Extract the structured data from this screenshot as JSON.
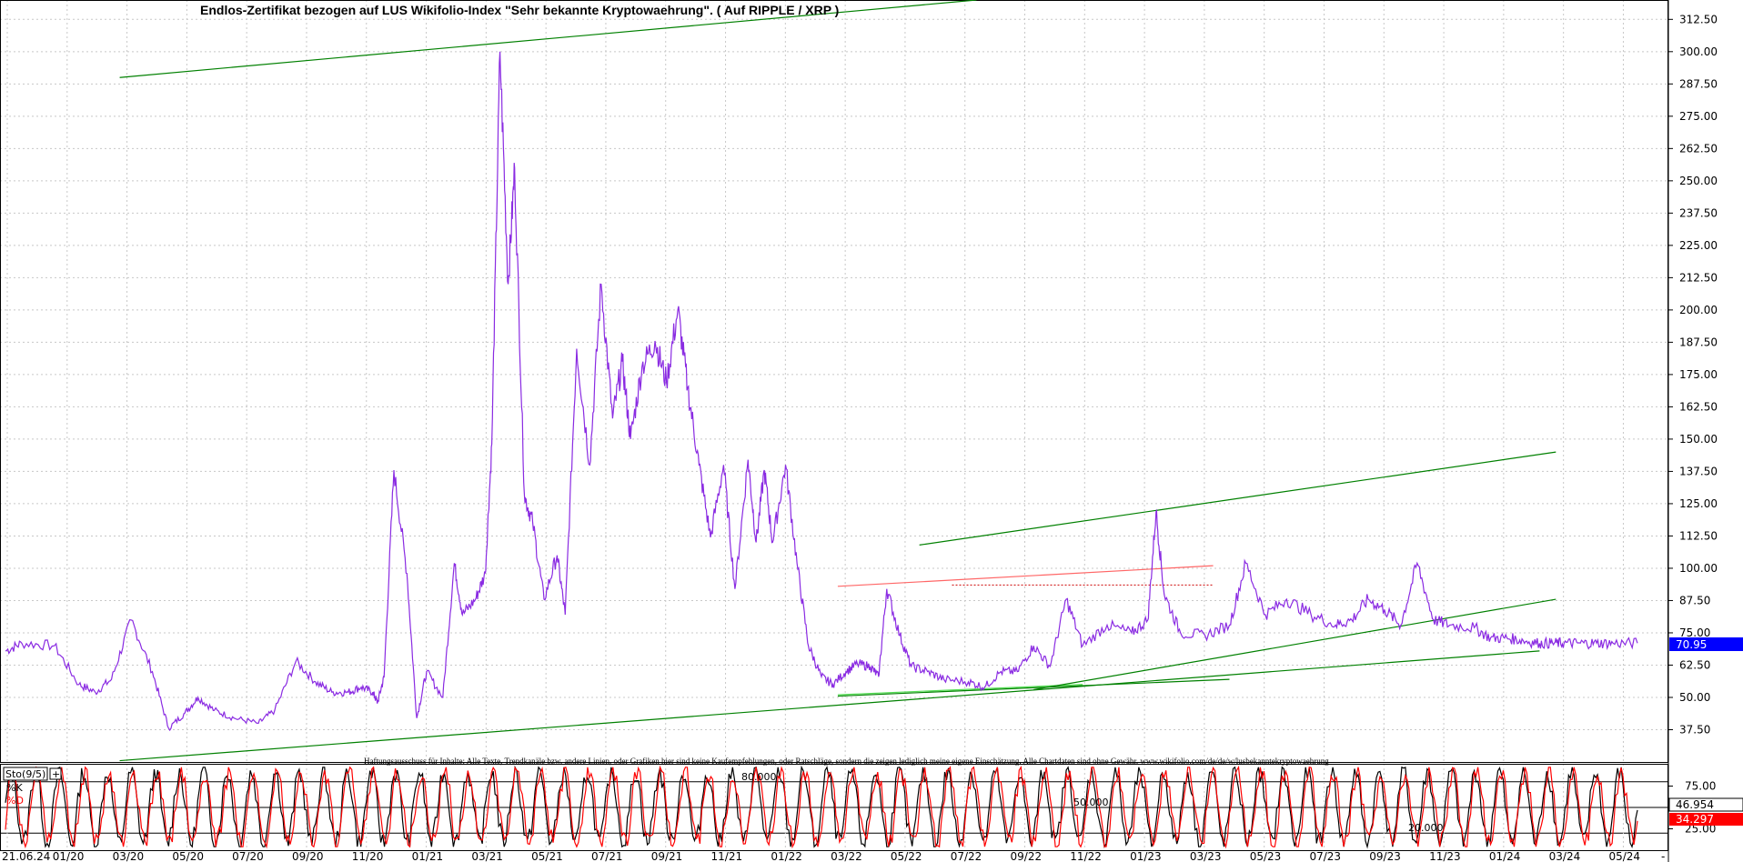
{
  "chart_data": [
    {
      "type": "line",
      "title": "Endlos-Zertifikat bezogen auf LUS Wikifolio-Index \"Sehr bekannte Kryptowaehrung\". ( Auf RIPPLE / XRP )",
      "disclaimer": "Haftungsausschuss für Inhalte: Alle Texte, Trendkanäle bzw. andere Linien, oder Grafiken hier sind keine Kaufempfehlungen, oder Ratschläge, sondern die zeigen lediglich meine eigene Einschätzung. Alle Chartdaten sind ohne Gewähr. www.wikifolio.com/de/de/w/lusbekanntekryptowaehrung",
      "ylim": [
        25,
        320
      ],
      "y_ticks": [
        37.5,
        50,
        62.5,
        75,
        87.5,
        100,
        112.5,
        125,
        137.5,
        150,
        162.5,
        175,
        187.5,
        200,
        212.5,
        225,
        237.5,
        250,
        262.5,
        275,
        287.5,
        300,
        312.5
      ],
      "y_tick_labels": [
        "37.50",
        "50.00",
        "62.50",
        "75.00",
        "87.50",
        "100.00",
        "112.50",
        "125.00",
        "137.50",
        "150.00",
        "162.50",
        "175.00",
        "187.50",
        "200.00",
        "212.50",
        "225.00",
        "237.50",
        "250.00",
        "262.50",
        "275.00",
        "287.50",
        "300.00",
        "312.50"
      ],
      "last_value_label": "70.95",
      "colors": {
        "price": "#8a2be2",
        "trend": "#008000",
        "resistance": "#ff6666",
        "resistance_dash": "#cc0000",
        "last_value_bg": "#0000ff"
      },
      "series": [
        {
          "x": [
            0,
            0.01,
            0.03,
            0.045,
            0.055,
            0.065,
            0.077,
            0.09,
            0.1,
            0.11,
            0.118,
            0.128,
            0.14,
            0.155,
            0.165,
            0.178,
            0.19,
            0.2,
            0.21,
            0.218,
            0.225,
            0.228,
            0.232,
            0.238,
            0.246,
            0.252,
            0.258,
            0.268,
            0.275,
            0.28,
            0.288,
            0.294,
            0.298,
            0.303,
            0.308,
            0.312,
            0.318,
            0.323,
            0.33,
            0.338,
            0.343,
            0.35,
            0.358,
            0.365,
            0.372,
            0.378,
            0.383,
            0.39,
            0.398,
            0.405,
            0.412,
            0.418,
            0.425,
            0.432,
            0.44,
            0.447,
            0.455,
            0.46,
            0.465,
            0.47,
            0.478,
            0.485,
            0.492,
            0.5,
            0.507,
            0.515,
            0.522,
            0.53,
            0.535,
            0.54,
            0.548,
            0.555,
            0.565,
            0.575,
            0.59,
            0.6,
            0.61,
            0.62,
            0.63,
            0.64,
            0.65,
            0.66,
            0.675,
            0.69,
            0.7,
            0.705,
            0.71,
            0.72,
            0.735,
            0.75,
            0.76,
            0.772,
            0.785,
            0.8,
            0.815,
            0.825,
            0.835,
            0.845,
            0.855,
            0.865,
            0.875,
            0.885,
            0.9,
            0.91,
            0.92,
            0.93,
            0.94,
            0.948,
            0.955,
            0.965,
            0.975,
            0.985,
            1.0
          ],
          "y": [
            68,
            71,
            70,
            55,
            52,
            57,
            80,
            60,
            38,
            44,
            50,
            45,
            42,
            40,
            45,
            64,
            56,
            52,
            52,
            54,
            52,
            48,
            58,
            138,
            98,
            42,
            60,
            50,
            102,
            82,
            88,
            98,
            148,
            300,
            210,
            255,
            128,
            118,
            88,
            105,
            82,
            185,
            140,
            210,
            158,
            180,
            150,
            178,
            188,
            172,
            200,
            170,
            140,
            112,
            140,
            92,
            142,
            110,
            138,
            110,
            140,
            102,
            70,
            58,
            55,
            60,
            63,
            62,
            58,
            92,
            74,
            62,
            60,
            57,
            56,
            54,
            60,
            60,
            70,
            62,
            88,
            70,
            78,
            75,
            80,
            122,
            90,
            75,
            74,
            78,
            102,
            82,
            88,
            82,
            78,
            80,
            88,
            84,
            78,
            102,
            80,
            78,
            77,
            73,
            73,
            72,
            70.95,
            71,
            71,
            71,
            71,
            71,
            71
          ]
        }
      ]
    },
    {
      "type": "line",
      "title": "",
      "indicator_label": "Sto(9/5)",
      "series_names": [
        "%K",
        "%D"
      ],
      "ylim": [
        0,
        100
      ],
      "levels": [
        20,
        50,
        80
      ],
      "level_labels": [
        "20.000",
        "50.000",
        "80.000"
      ],
      "y_ticks": [
        25,
        50,
        75
      ],
      "y_tick_labels": [
        "25.00",
        "50.00",
        "75.00"
      ],
      "last_k_label": "46.954",
      "last_d_label": "34.297",
      "colors": {
        "k": "#000000",
        "d": "#ff0000",
        "d_bg": "#ff0000"
      },
      "series": [
        {
          "name": "%K",
          "cycles": 68,
          "last": 46.954
        },
        {
          "name": "%D",
          "cycles": 68,
          "last": 34.297
        }
      ]
    }
  ],
  "x_axis": {
    "labels": [
      "21.06.24",
      "01/20",
      "03/20",
      "05/20",
      "07/20",
      "09/20",
      "11/20",
      "01/21",
      "03/21",
      "05/21",
      "07/21",
      "09/21",
      "11/21",
      "01/22",
      "03/22",
      "05/22",
      "07/22",
      "09/22",
      "11/22",
      "01/23",
      "03/23",
      "05/23",
      "07/23",
      "09/23",
      "11/23",
      "01/24",
      "03/24",
      "05/24"
    ],
    "label_positions": [
      0,
      0.064,
      0.112,
      0.158,
      0.204,
      0.248,
      0.293,
      0.338,
      0.382,
      0.427,
      0.472,
      0.515,
      0.56,
      0.604,
      0.648,
      0.692,
      0.737,
      0.781,
      0.826,
      0.87,
      0.913,
      0.958,
      1.0,
      1.045,
      1.09,
      1.135,
      1.18,
      1.225
    ]
  },
  "side_mark": "-"
}
